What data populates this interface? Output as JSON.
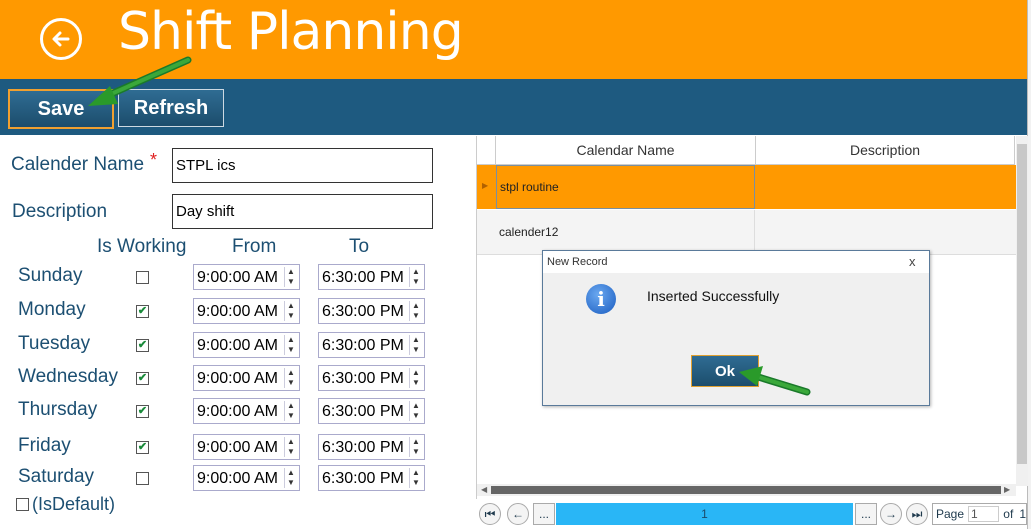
{
  "header": {
    "title": "Shift Planning",
    "back_icon": "back-arrow-icon"
  },
  "toolbar": {
    "save_label": "Save",
    "refresh_label": "Refresh"
  },
  "form": {
    "calendar_name_label": "Calender Name",
    "required_mark": "*",
    "calendar_name_value": "STPL ics",
    "description_label": "Description",
    "description_value": "Day shift",
    "col_is_working": "Is Working",
    "col_from": "From",
    "col_to": "To",
    "days": [
      {
        "name": "Sunday",
        "working": false,
        "from": "9:00:00 AM",
        "to": "6:30:00 PM"
      },
      {
        "name": "Monday",
        "working": true,
        "from": "9:00:00 AM",
        "to": "6:30:00 PM"
      },
      {
        "name": "Tuesday",
        "working": true,
        "from": "9:00:00 AM",
        "to": "6:30:00 PM"
      },
      {
        "name": "Wednesday",
        "working": true,
        "from": "9:00:00 AM",
        "to": "6:30:00 PM"
      },
      {
        "name": "Thursday",
        "working": true,
        "from": "9:00:00 AM",
        "to": "6:30:00 PM"
      },
      {
        "name": "Friday",
        "working": true,
        "from": "9:00:00 AM",
        "to": "6:30:00 PM"
      },
      {
        "name": "Saturday",
        "working": false,
        "from": "9:00:00 AM",
        "to": "6:30:00 PM"
      }
    ],
    "is_default_label": "(IsDefault)"
  },
  "grid": {
    "columns": [
      "Calendar Name",
      "Description"
    ],
    "rows": [
      {
        "name": "stpl routine",
        "description": ""
      },
      {
        "name": "calender12",
        "description": ""
      }
    ]
  },
  "dialog": {
    "title": "New Record",
    "message": "Inserted Successfully",
    "ok_label": "Ok",
    "close_glyph": "x"
  },
  "pager": {
    "ellipsis": "...",
    "current_page": "1",
    "page_label": "Page",
    "page_value": "1",
    "of_label": "of",
    "total_pages": "1"
  },
  "colors": {
    "header": "#ff9900",
    "toolbar": "#1e5a80",
    "selected_row": "#ff9900",
    "pager_active": "#29b6f6"
  }
}
